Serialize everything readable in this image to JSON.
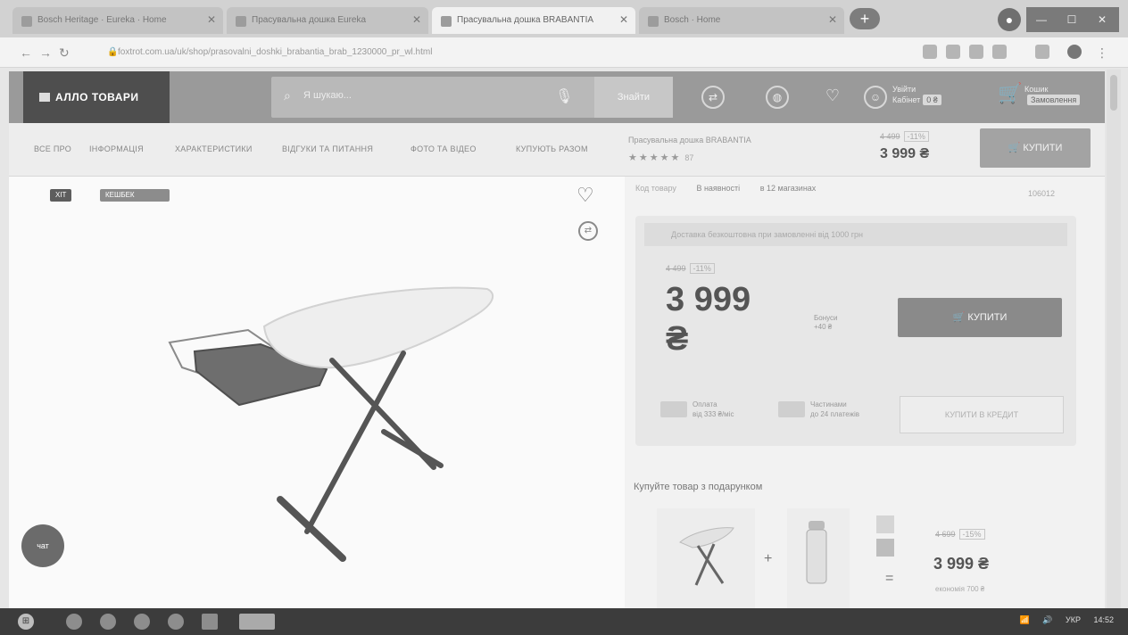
{
  "browser": {
    "tabs": [
      {
        "title": "Bosch Heritage · Eureka · Home",
        "active": false
      },
      {
        "title": "Прасувальна дошка Eureka",
        "active": false
      },
      {
        "title": "Прасувальна дошка BRABANTIA",
        "active": true
      },
      {
        "title": "Bosch · Home",
        "active": false
      }
    ],
    "url": "foxtrot.com.ua/uk/shop/prasovalni_doshki_brabantia_brab_1230000_pr_wl.html"
  },
  "header": {
    "logo": "АЛЛО ТОВАРИ",
    "search_placeholder": "Я шукаю...",
    "search_button": "Знайти",
    "account_line1": "Увійти",
    "account_line2": "Кабінет",
    "account_badge": "0 ₴",
    "cart_line1": "Кошик",
    "cart_badge": "Замовлення"
  },
  "product_nav": {
    "items": [
      "ВСЕ ПРО",
      "ІНФОРМАЦІЯ",
      "ХАРАКТЕРИСТИКИ",
      "ВІДГУКИ ТА ПИТАННЯ",
      "ФОТО ТА ВІДЕО",
      "КУПУЮТЬ РАЗОМ"
    ],
    "mini_title": "Прасувальна дошка BRABANTIA",
    "mini_stars": "★★★★★",
    "mini_reviews": "87",
    "old_price": "4 499",
    "discount": "-11%",
    "price": "3 999 ₴",
    "buy_label": "КУПИТИ"
  },
  "gallery": {
    "labels": [
      {
        "text": "ХІТ",
        "color": "#5d5d5d"
      },
      {
        "text": "КЕШБЕК",
        "color": "#8c8c8c"
      }
    ],
    "chat_label": "чат"
  },
  "info": {
    "code_label": "Код товару",
    "status": "В наявності",
    "availability": "в 12 магазинах",
    "code_value": "106012",
    "promo_text": "Доставка безкоштовна при замовленні від 1000 грн",
    "old_price": "4 499",
    "discount": "-11%",
    "price": "3 999 ₴",
    "bonus_line1": "Бонуси",
    "bonus_line2": "+40 ₴",
    "buy_label": "КУПИТИ",
    "opt1_line1": "Оплата",
    "opt1_line2": "від 333 ₴/міс",
    "opt2_line1": "Частинами",
    "opt2_line2": "до 24 платежів",
    "credit_label": "КУПИТИ В КРЕДИТ",
    "bundle_title": "Купуйте товар з подарунком",
    "bundle_old": "4 699",
    "bundle_discount": "-15%",
    "bundle_price": "3 999 ₴",
    "bundle_save": "економія 700 ₴"
  },
  "taskbar": {
    "lang": "УКР",
    "time": "14:52"
  }
}
